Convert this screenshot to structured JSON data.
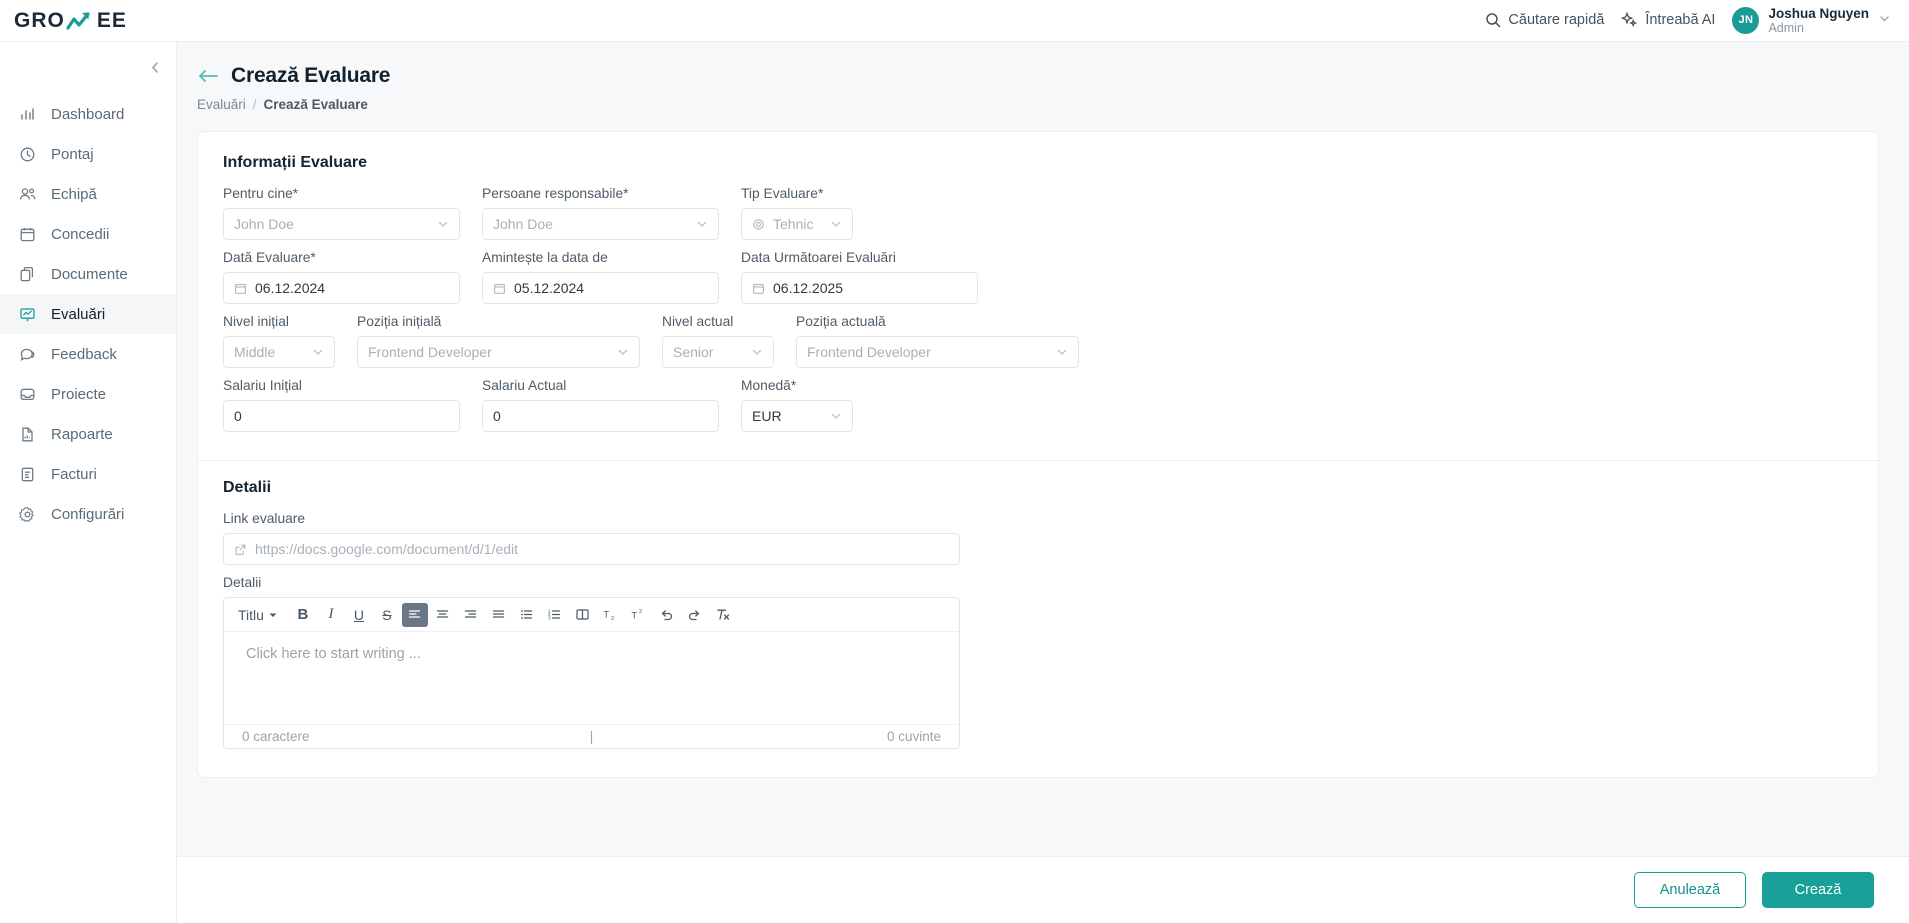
{
  "brand": {
    "name_left": "GRO",
    "name_right": "EE",
    "accent": "#1a9c96"
  },
  "topbar": {
    "search_label": "Căutare rapidă",
    "ai_label": "Întreabă AI",
    "user": {
      "initials": "JN",
      "name": "Joshua Nguyen",
      "role": "Admin"
    }
  },
  "sidebar": {
    "items": [
      {
        "label": "Dashboard",
        "icon": "chart-bar-icon",
        "active": false
      },
      {
        "label": "Pontaj",
        "icon": "clock-icon",
        "active": false
      },
      {
        "label": "Echipă",
        "icon": "users-icon",
        "active": false
      },
      {
        "label": "Concedii",
        "icon": "calendar-icon",
        "active": false
      },
      {
        "label": "Documente",
        "icon": "documents-icon",
        "active": false
      },
      {
        "label": "Evaluări",
        "icon": "evaluation-icon",
        "active": true
      },
      {
        "label": "Feedback",
        "icon": "chat-icon",
        "active": false
      },
      {
        "label": "Proiecte",
        "icon": "inbox-icon",
        "active": false
      },
      {
        "label": "Rapoarte",
        "icon": "report-icon",
        "active": false
      },
      {
        "label": "Facturi",
        "icon": "invoice-icon",
        "active": false
      },
      {
        "label": "Configurări",
        "icon": "gear-icon",
        "active": false
      }
    ]
  },
  "page": {
    "title": "Crează Evaluare",
    "breadcrumb": {
      "parent": "Evaluări",
      "separator": "/",
      "current": "Crează Evaluare"
    }
  },
  "form": {
    "section_title": "Informații Evaluare",
    "row1": [
      {
        "label": "Pentru cine*",
        "value": "John Doe",
        "is_placeholder": true,
        "control": "select"
      },
      {
        "label": "Persoane responsabile*",
        "value": "John Doe",
        "is_placeholder": true,
        "control": "select"
      },
      {
        "label": "Tip Evaluare*",
        "value": "Tehnic",
        "is_placeholder": true,
        "control": "select",
        "lead_icon": "gear-icon"
      }
    ],
    "row2": [
      {
        "label": "Dată Evaluare*",
        "value": "06.12.2024",
        "is_placeholder": false,
        "control": "date",
        "lead_icon": "calendar-icon"
      },
      {
        "label": "Amintește la data de",
        "value": "05.12.2024",
        "is_placeholder": false,
        "control": "date",
        "lead_icon": "calendar-icon"
      },
      {
        "label": "Data Următoarei Evaluări",
        "value": "06.12.2025",
        "is_placeholder": false,
        "control": "date",
        "lead_icon": "calendar-icon"
      }
    ],
    "row3": [
      {
        "label": "Nivel inițial",
        "value": "Middle",
        "is_placeholder": true,
        "control": "select"
      },
      {
        "label": "Poziția inițială",
        "value": "Frontend Developer",
        "is_placeholder": true,
        "control": "select"
      },
      {
        "label": "Nivel actual",
        "value": "Senior",
        "is_placeholder": true,
        "control": "select"
      },
      {
        "label": "Poziția actuală",
        "value": "Frontend Developer",
        "is_placeholder": true,
        "control": "select"
      }
    ],
    "row4": [
      {
        "label": "Salariu Inițial",
        "value": "0",
        "is_placeholder": false,
        "control": "text"
      },
      {
        "label": "Salariu Actual",
        "value": "0",
        "is_placeholder": false,
        "control": "text"
      },
      {
        "label": "Monedă*",
        "value": "EUR",
        "is_placeholder": false,
        "control": "select"
      }
    ]
  },
  "details": {
    "section_title": "Detalii",
    "link_label": "Link evaluare",
    "link_placeholder": "https://docs.google.com/document/d/1/edit",
    "link_icon": "external-link-icon",
    "editor_label": "Detalii",
    "toolbar": {
      "style_select": "Titlu",
      "buttons": [
        {
          "name": "bold",
          "glyph": "B",
          "active": false
        },
        {
          "name": "italic",
          "glyph": "I",
          "active": false
        },
        {
          "name": "underline",
          "glyph": "U",
          "active": false
        },
        {
          "name": "strikethrough",
          "glyph": "S",
          "active": false
        },
        {
          "name": "align-left",
          "glyph": "",
          "active": true
        },
        {
          "name": "align-center",
          "glyph": "",
          "active": false
        },
        {
          "name": "align-right",
          "glyph": "",
          "active": false
        },
        {
          "name": "align-justify",
          "glyph": "",
          "active": false
        },
        {
          "name": "bullet-list",
          "glyph": "",
          "active": false
        },
        {
          "name": "numbered-list",
          "glyph": "",
          "active": false
        },
        {
          "name": "columns",
          "glyph": "",
          "active": false
        },
        {
          "name": "subscript",
          "glyph": "",
          "active": false
        },
        {
          "name": "superscript",
          "glyph": "",
          "active": false
        },
        {
          "name": "undo",
          "glyph": "",
          "active": false
        },
        {
          "name": "redo",
          "glyph": "",
          "active": false
        },
        {
          "name": "clear-format",
          "glyph": "",
          "active": false
        }
      ]
    },
    "editor_placeholder": "Click here to start writing ...",
    "char_count": "0 caractere",
    "word_count": "0 cuvinte"
  },
  "footer": {
    "cancel_label": "Anulează",
    "submit_label": "Crează"
  }
}
